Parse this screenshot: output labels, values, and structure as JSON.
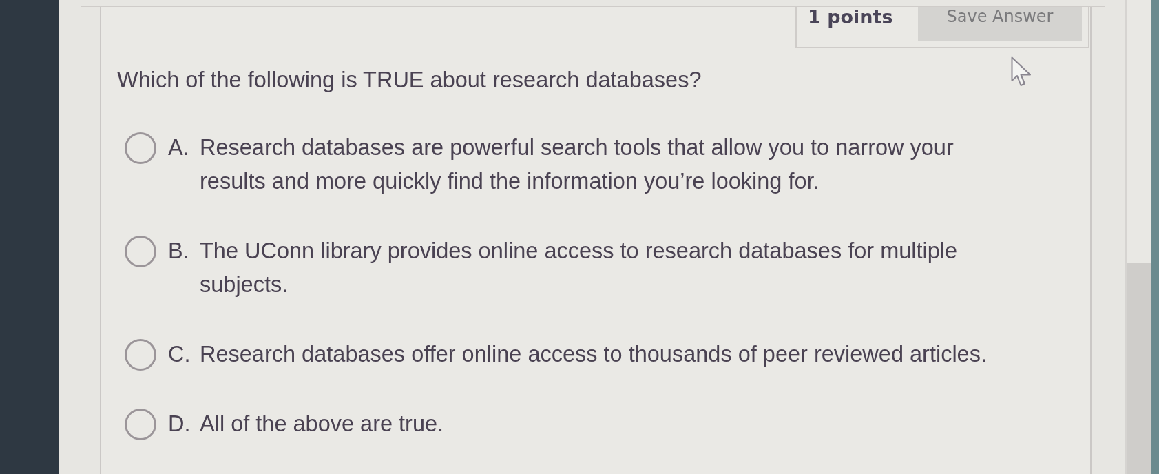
{
  "header": {
    "points": "1 points",
    "save_button": "Save Answer"
  },
  "question": "Which of the following is TRUE about research databases?",
  "options": [
    {
      "letter": "A.",
      "text": "Research databases are powerful search tools that allow you to narrow your results and more quickly find the information you’re looking for.",
      "selected": false
    },
    {
      "letter": "B.",
      "text": "The UConn library provides online access to research databases for multiple subjects.",
      "selected": false
    },
    {
      "letter": "C.",
      "text": "Research databases offer online access to thousands of peer reviewed articles.",
      "selected": false
    },
    {
      "letter": "D.",
      "text": "All of the above are true.",
      "selected": false
    }
  ]
}
